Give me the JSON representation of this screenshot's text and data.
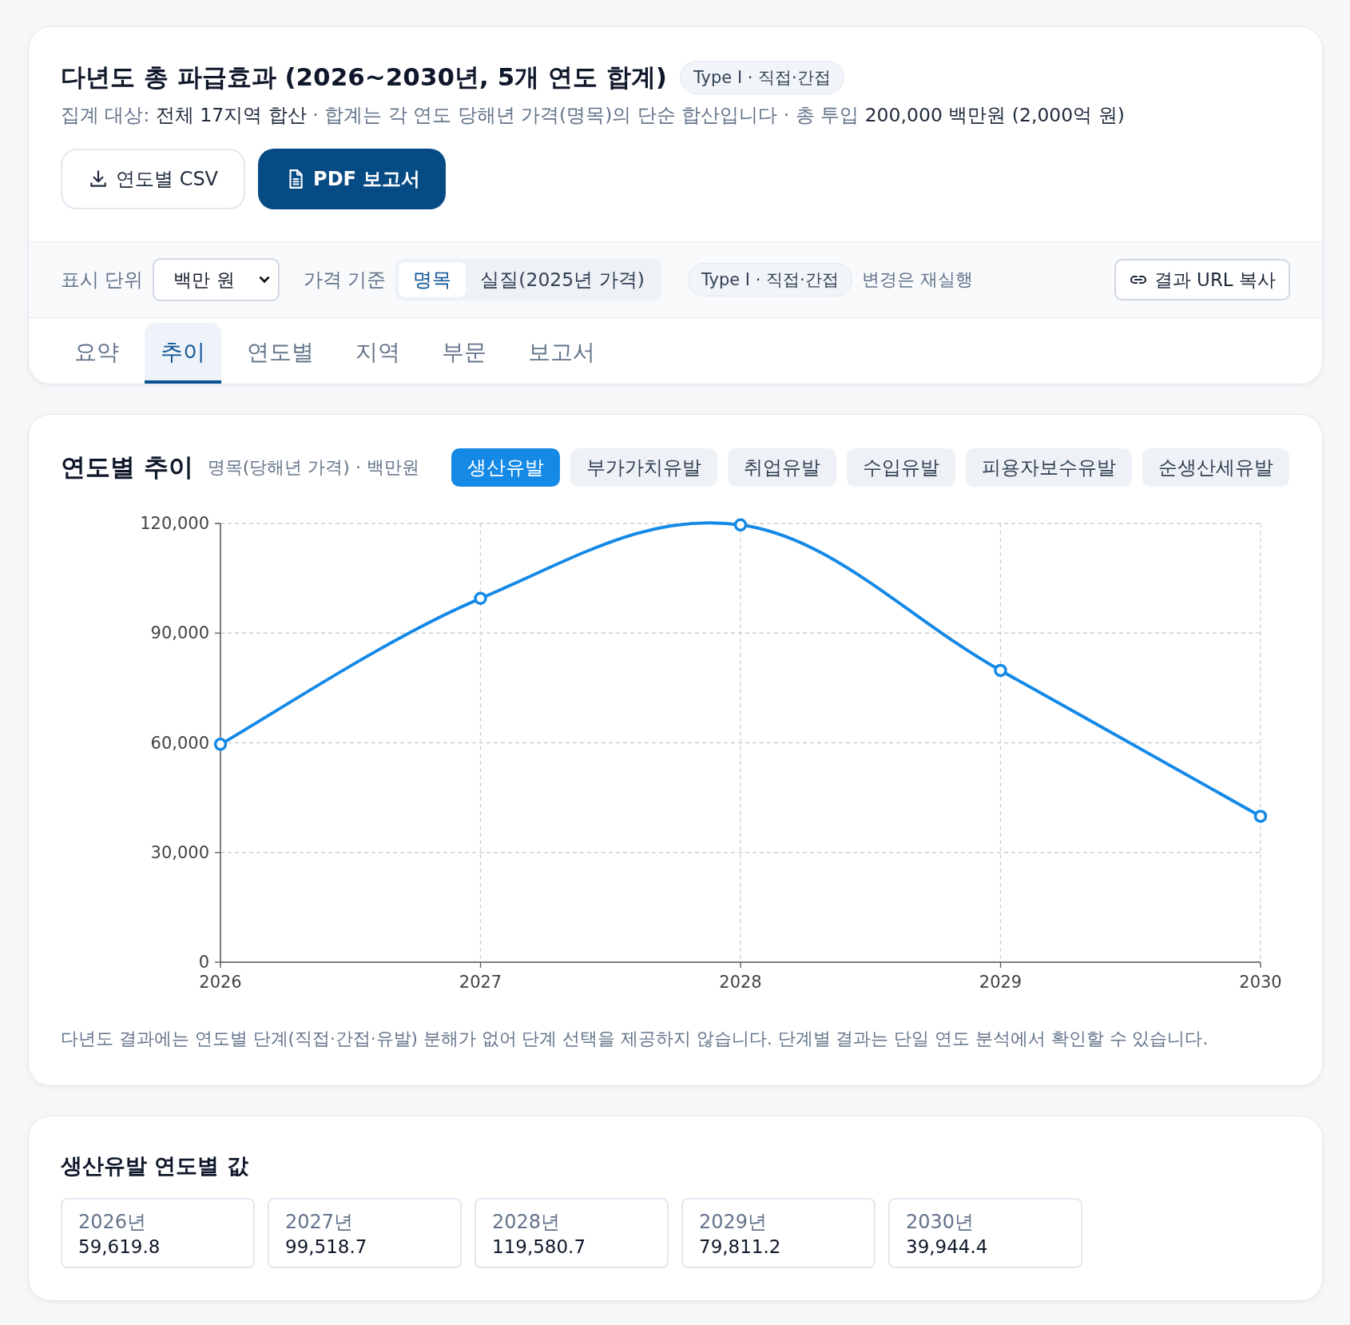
{
  "header": {
    "title": "다년도 총 파급효과 (2026~2030년, 5개 연도 합계)",
    "badge": "Type I · 직접·간접",
    "subtitle": [
      {
        "text": "집계 대상:",
        "strong": false
      },
      {
        "text": "전체 17지역 합산",
        "strong": true
      },
      {
        "text": "· 합계는 각 연도 당해년 가격(명목)의 단순 합산입니다 · 총 투입",
        "strong": false
      },
      {
        "text": "200,000 백만원 (2,000억 원)",
        "strong": true
      }
    ],
    "buttons": [
      {
        "label": "연도별 CSV",
        "kind": "outline"
      },
      {
        "label": "PDF 보고서",
        "kind": "primary"
      }
    ]
  },
  "toolbar": {
    "unit_label": "표시 단위",
    "unit_select": "백만 원",
    "price_label": "가격 기준",
    "price_options": [
      {
        "label": "명목",
        "selected": true
      },
      {
        "label": "실질(2025년 가격)",
        "selected": false
      }
    ],
    "type_badge": "Type I · 직접·간접",
    "rerun_note": "변경은 재실행",
    "copy_button": "결과 URL 복사"
  },
  "tabs": [
    {
      "label": "요약",
      "selected": false
    },
    {
      "label": "추이",
      "selected": true
    },
    {
      "label": "연도별",
      "selected": false
    },
    {
      "label": "지역",
      "selected": false
    },
    {
      "label": "부문",
      "selected": false
    },
    {
      "label": "보고서",
      "selected": false
    }
  ],
  "trend": {
    "title": "연도별 추이",
    "subtitle": "명목(당해년 가격) · 백만원",
    "metrics": [
      {
        "label": "생산유발",
        "selected": true
      },
      {
        "label": "부가가치유발",
        "selected": false
      },
      {
        "label": "취업유발",
        "selected": false
      },
      {
        "label": "수입유발",
        "selected": false
      },
      {
        "label": "피용자보수유발",
        "selected": false
      },
      {
        "label": "순생산세유발",
        "selected": false
      }
    ],
    "chart_data": {
      "type": "line",
      "categories": [
        "2026",
        "2027",
        "2028",
        "2029",
        "2030"
      ],
      "grid": true,
      "series": [
        {
          "color": "#1589e6",
          "marker": "circle",
          "values": [
            59600,
            99500,
            119600,
            79800,
            39900
          ]
        }
      ],
      "ylim": [
        0,
        120000
      ],
      "yticks": [
        {
          "value": 0,
          "label": "0"
        },
        {
          "value": 30000,
          "label": "30,000"
        },
        {
          "value": 60000,
          "label": "60,000"
        },
        {
          "value": 90000,
          "label": "90,000"
        },
        {
          "value": 120000,
          "label": "120,000"
        }
      ]
    },
    "footnote": "다년도 결과에는 연도별 단계(직접·간접·유발) 분해가 없어 단계 선택을 제공하지 않습니다. 단계별 결과는 단일 연도 분석에서 확인할 수 있습니다."
  },
  "values": {
    "title": "생산유발 연도별 값",
    "items": [
      {
        "year": "2026년",
        "value": "59,619.8"
      },
      {
        "year": "2027년",
        "value": "99,518.7"
      },
      {
        "year": "2028년",
        "value": "119,580.7"
      },
      {
        "year": "2029년",
        "value": "79,811.2"
      },
      {
        "year": "2030년",
        "value": "39,944.4"
      }
    ]
  }
}
